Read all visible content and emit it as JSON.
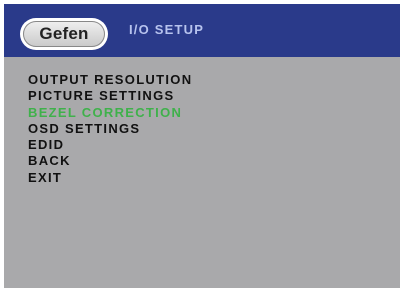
{
  "header": {
    "logo_text": "Gefen",
    "title": "I/O SETUP"
  },
  "menu": {
    "items": [
      {
        "label": "OUTPUT RESOLUTION",
        "selected": false
      },
      {
        "label": "PICTURE SETTINGS",
        "selected": false
      },
      {
        "label": "BEZEL CORRECTION",
        "selected": true
      },
      {
        "label": "OSD SETTINGS",
        "selected": false
      },
      {
        "label": "EDID",
        "selected": false
      },
      {
        "label": "BACK",
        "selected": false
      },
      {
        "label": "EXIT",
        "selected": false
      }
    ]
  },
  "colors": {
    "header_bg": "#2a3a8a",
    "panel_bg": "#a9a9ab",
    "title_text": "#b7c3ee",
    "menu_text": "#111111",
    "selected_text": "#3fb14b"
  }
}
